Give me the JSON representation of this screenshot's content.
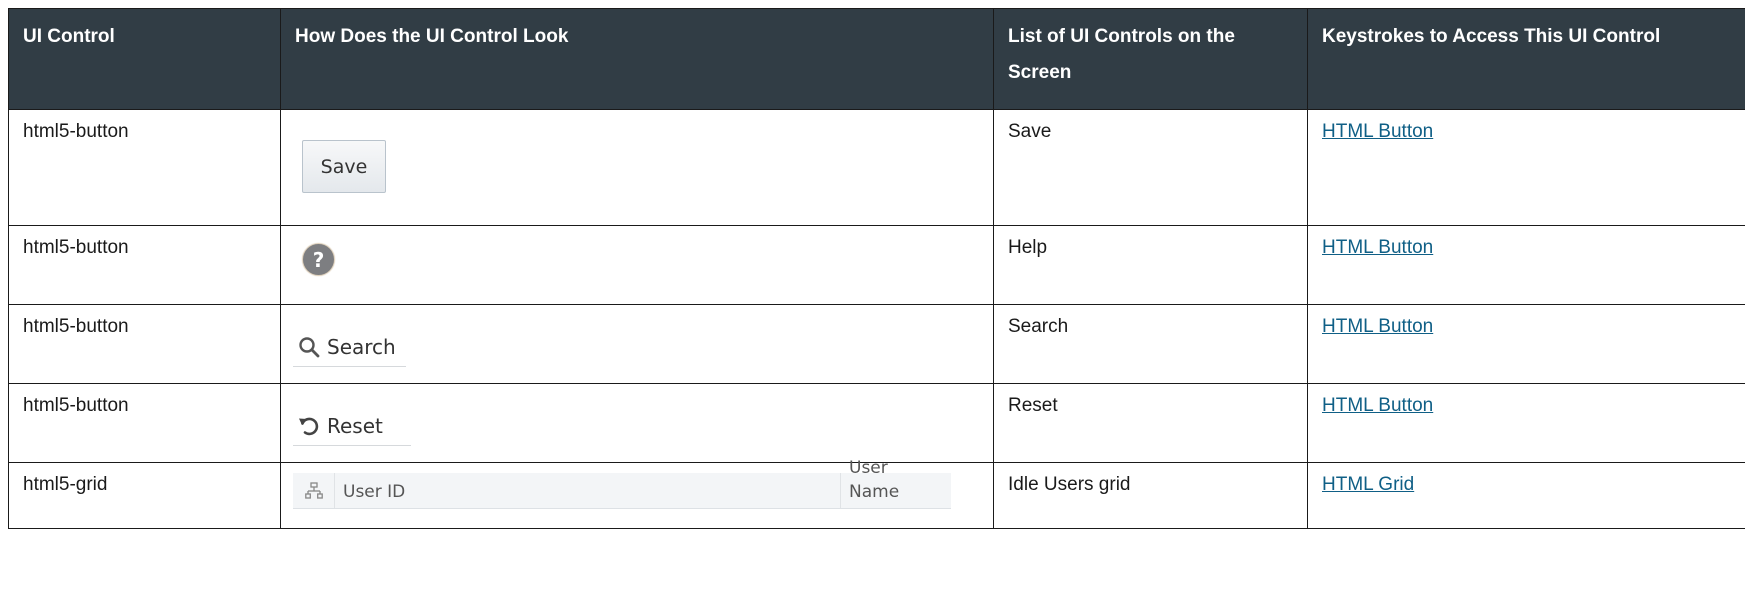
{
  "table": {
    "headers": [
      "UI Control",
      "How Does the UI Control Look",
      "List of UI Controls on the Screen",
      "Keystrokes to Access This UI Control"
    ],
    "rows": [
      {
        "control": "html5-button",
        "look": {
          "type": "save-button",
          "label": "Save"
        },
        "list": "Save",
        "keystrokes": "HTML Button"
      },
      {
        "control": "html5-button",
        "look": {
          "type": "help-icon",
          "label": "?"
        },
        "list": "Help",
        "keystrokes": "HTML Button"
      },
      {
        "control": "html5-button",
        "look": {
          "type": "search-button",
          "label": "Search",
          "icon": "search-icon"
        },
        "list": "Search",
        "keystrokes": "HTML Button"
      },
      {
        "control": "html5-button",
        "look": {
          "type": "reset-button",
          "label": "Reset",
          "icon": "reset-icon"
        },
        "list": "Reset",
        "keystrokes": "HTML Button"
      },
      {
        "control": "html5-grid",
        "look": {
          "type": "grid-header",
          "columns": [
            "User ID",
            "User Name"
          ],
          "icon": "hierarchy-icon"
        },
        "list": "Idle Users grid",
        "keystrokes": "HTML Grid"
      }
    ]
  },
  "colors": {
    "header_bg": "#313d45",
    "header_text": "#ffffff",
    "link": "#0f5f86",
    "border": "#1a1a1a"
  }
}
